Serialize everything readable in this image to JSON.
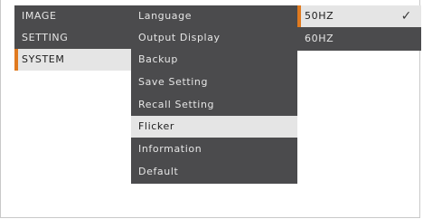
{
  "main_menu": {
    "items": [
      {
        "label": "IMAGE",
        "selected": false
      },
      {
        "label": "SETTING",
        "selected": false
      },
      {
        "label": "SYSTEM",
        "selected": true
      }
    ]
  },
  "system_menu": {
    "items": [
      {
        "label": "Language",
        "selected": false
      },
      {
        "label": "Output Display",
        "selected": false
      },
      {
        "label": "Backup",
        "selected": false
      },
      {
        "label": "Save Setting",
        "selected": false
      },
      {
        "label": "Recall Setting",
        "selected": false
      },
      {
        "label": "Flicker",
        "selected": true
      },
      {
        "label": "Information",
        "selected": false
      },
      {
        "label": "Default",
        "selected": false
      }
    ]
  },
  "flicker_menu": {
    "items": [
      {
        "label": "50HZ",
        "selected": true,
        "checked": true
      },
      {
        "label": "60HZ",
        "selected": false,
        "checked": false
      }
    ],
    "check_icon": "✓"
  },
  "colors": {
    "menu_bg": "#4b4b4d",
    "highlight_bg": "#e5e5e5",
    "accent": "#e07a1f"
  }
}
